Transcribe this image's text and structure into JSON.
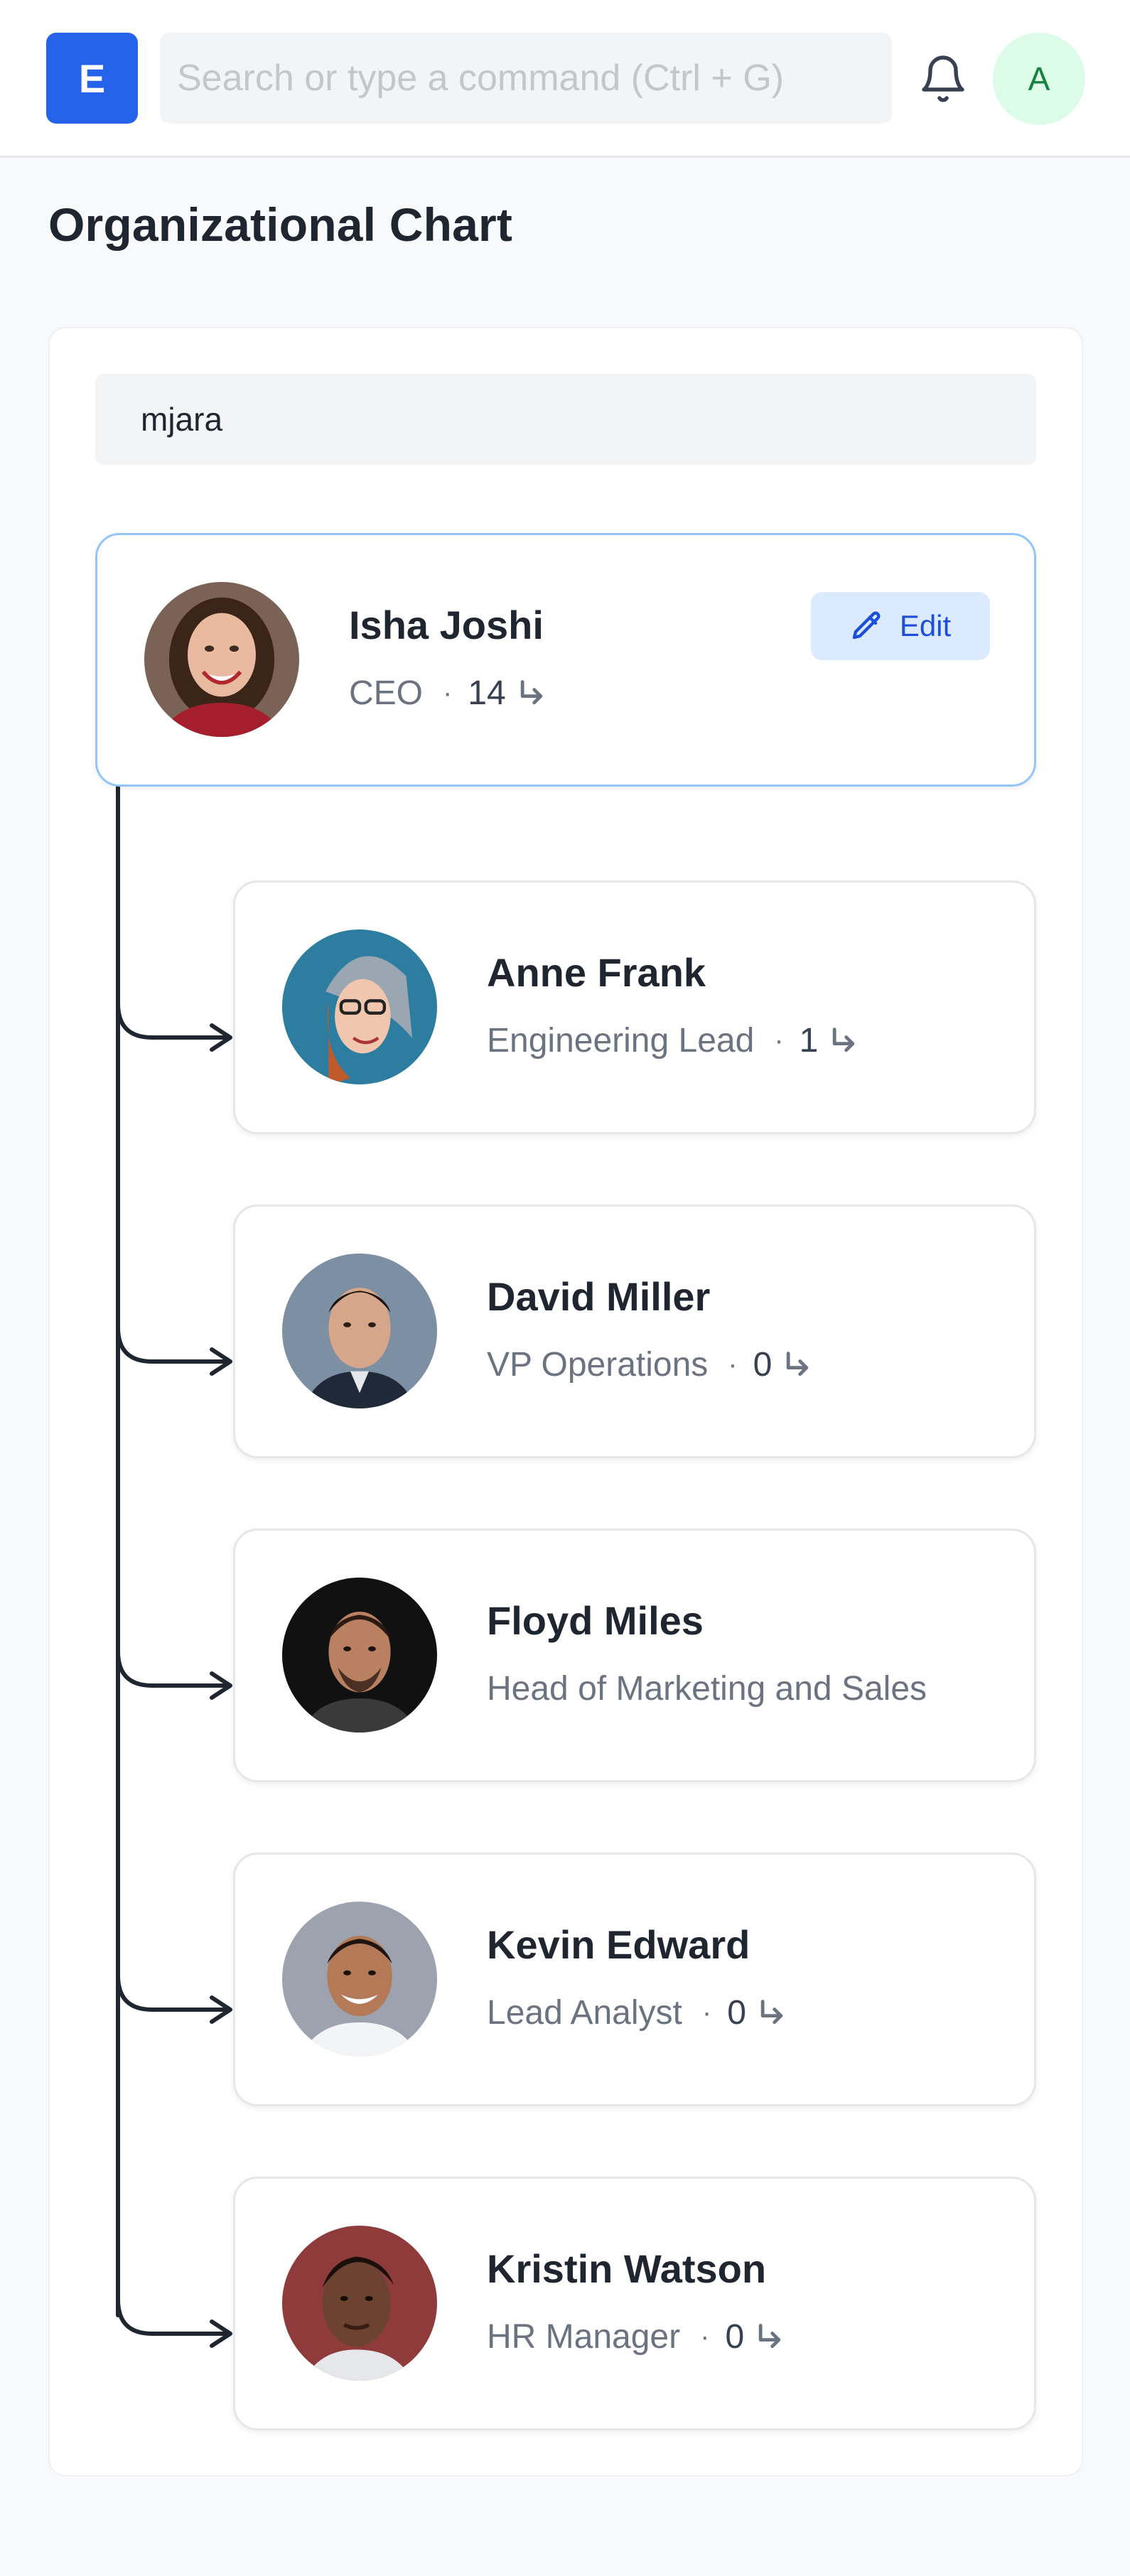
{
  "app": {
    "logo_letter": "E",
    "search_placeholder": "Search or type a command (Ctrl + G)",
    "user_initial": "A"
  },
  "page": {
    "title": "Organizational Chart",
    "company": "mjara"
  },
  "root": {
    "name": "Isha Joshi",
    "title": "CEO",
    "reports": "14",
    "edit_label": "Edit"
  },
  "children": [
    {
      "name": "Anne Frank",
      "title": "Engineering Lead",
      "reports": "1"
    },
    {
      "name": "David Miller",
      "title": "VP Operations",
      "reports": "0"
    },
    {
      "name": "Floyd Miles",
      "title": "Head of Marketing and Sales",
      "reports": ""
    },
    {
      "name": "Kevin Edward",
      "title": "Lead Analyst",
      "reports": "0"
    },
    {
      "name": "Kristin Watson",
      "title": "HR Manager",
      "reports": "0"
    }
  ],
  "colors": {
    "accent": "#2563eb",
    "root_border": "#93c5fd",
    "edit_bg": "#dbeafe",
    "avatar_bg": "#dcfce7",
    "avatar_text": "#15803d"
  }
}
